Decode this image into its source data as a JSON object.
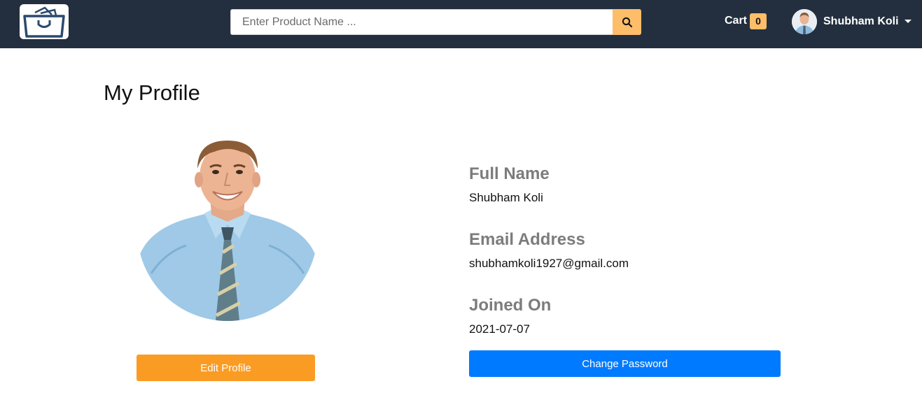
{
  "header": {
    "logo_icon": "shopping-bag-icon",
    "search": {
      "placeholder": "Enter Product Name ...",
      "value": "",
      "button_icon": "search-icon"
    },
    "cart": {
      "label": "Cart",
      "count": "0"
    },
    "user": {
      "name": "Shubham Koli",
      "menu_icon": "caret-down-icon"
    },
    "colors": {
      "navbar": "#232f3e",
      "accent": "#febd69"
    }
  },
  "profile": {
    "title": "My Profile",
    "fields": [
      {
        "label": "Full Name",
        "value": "Shubham Koli"
      },
      {
        "label": "Email Address",
        "value": "shubhamkoli1927@gmail.com"
      },
      {
        "label": "Joined On",
        "value": "2021-07-07"
      }
    ],
    "edit_button": "Edit Profile",
    "change_password_button": "Change Password",
    "colors": {
      "edit_button": "#fa9c23",
      "change_password_button": "#007bff"
    }
  }
}
